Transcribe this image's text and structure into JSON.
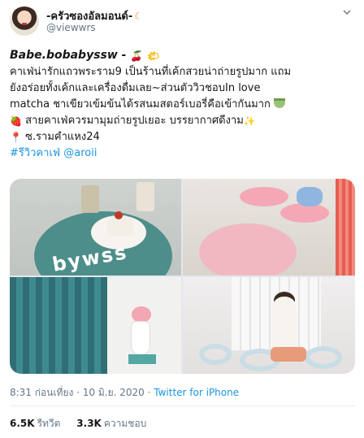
{
  "author": {
    "display_name": "-ครัวซองอัลมอนด์-",
    "croissant_icon": "croissant-icon",
    "handle": "@viewwrs"
  },
  "tweet": {
    "line1": "Babe.bobabyssw",
    "line1_sep": " - ",
    "line2": "คาเฟ่น่ารักแถวพระราม9 เป็นร้านที่เค้กสวยน่าถ่ายรูปมาก แถม",
    "line3": "ยังอร่อยทั้งเค้กและเครื่องดื่มเลย~ส่วนตัววิวชอบIn love",
    "line4": "matcha ชาเขียวเข้มข้นได้รสนมสตอร์เบอรี่คือเข้ากันมาก",
    "line5": "สายคาเฟ่ควรมามุมถ่ายรูปเยอะ บรรยากาศดีงาม",
    "line6": "ซ.รามคำแหง24",
    "hashtag": "#รีวิวคาเฟ่",
    "mention": "@aroii"
  },
  "icons": {
    "cherry": "🍒",
    "sun": "🌤",
    "strawberry": "🍓",
    "sparkle": "✨",
    "pin": "📍"
  },
  "meta": {
    "time": "8:31 ก่อนเที่ยง",
    "dot": " · ",
    "date": "10 มิ.ย. 2020",
    "source": "Twitter for iPhone"
  },
  "stats": {
    "retweets_count": "6.5K",
    "retweets_label": "รีทวีต",
    "likes_count": "3.3K",
    "likes_label": "ความชอบ"
  },
  "media": {
    "image1_sign": "bywss"
  }
}
